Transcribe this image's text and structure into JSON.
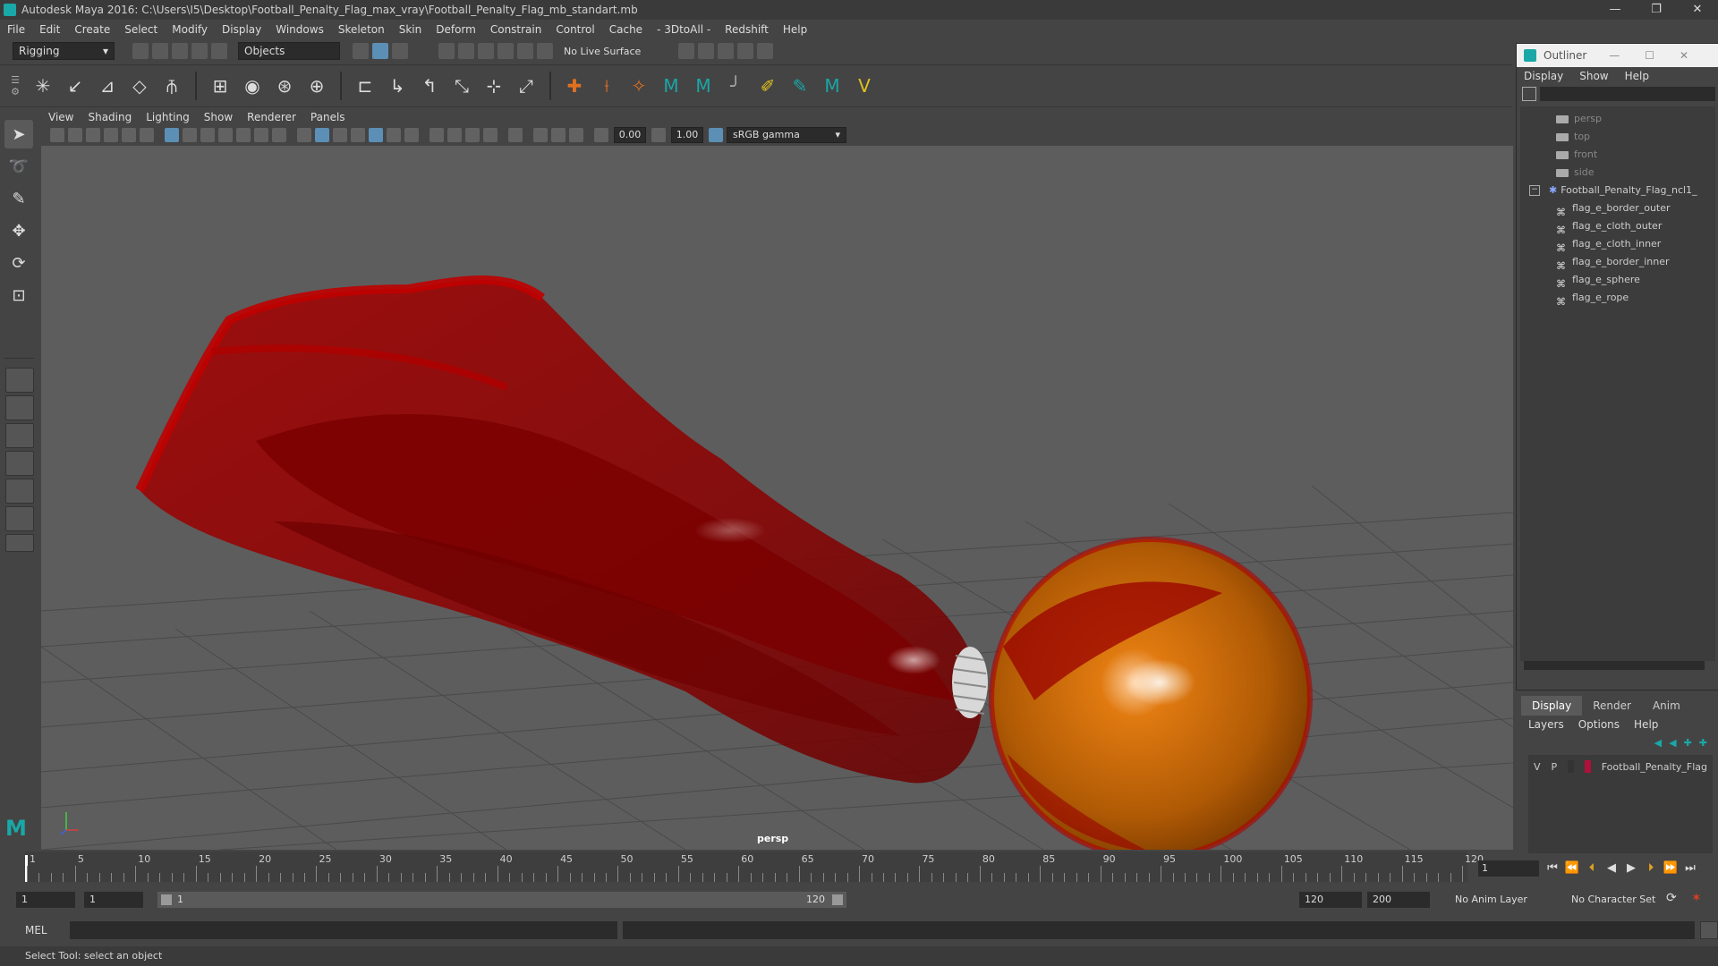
{
  "window": {
    "title": "Autodesk Maya 2016: C:\\Users\\I5\\Desktop\\Football_Penalty_Flag_max_vray\\Football_Penalty_Flag_mb_standart.mb",
    "minimize": "—",
    "restore": "❐",
    "close": "✕"
  },
  "menu": [
    "File",
    "Edit",
    "Create",
    "Select",
    "Modify",
    "Display",
    "Windows",
    "Skeleton",
    "Skin",
    "Deform",
    "Constrain",
    "Control",
    "Cache",
    "- 3DtoAll -",
    "Redshift",
    "Help"
  ],
  "status_line": {
    "mode": "Rigging",
    "selection_mode": "Objects",
    "live_surface": "No Live Surface"
  },
  "viewport": {
    "menu": [
      "View",
      "Shading",
      "Lighting",
      "Show",
      "Renderer",
      "Panels"
    ],
    "exposure": "0.00",
    "gamma": "1.00",
    "color_space": "sRGB gamma",
    "camera_label": "persp"
  },
  "outliner": {
    "title": "Outliner",
    "menu": [
      "Display",
      "Show",
      "Help"
    ],
    "cameras": [
      "persp",
      "top",
      "front",
      "side"
    ],
    "group": "Football_Penalty_Flag_ncl1_",
    "children": [
      "flag_e_border_outer",
      "flag_e_cloth_outer",
      "flag_e_cloth_inner",
      "flag_e_border_inner",
      "flag_e_sphere",
      "flag_e_rope"
    ]
  },
  "layer_editor": {
    "tabs": [
      "Display",
      "Render",
      "Anim"
    ],
    "menu": [
      "Layers",
      "Options",
      "Help"
    ],
    "layer": {
      "v": "V",
      "p": "P",
      "name": "Football_Penalty_Flag",
      "color": "#b0103a"
    }
  },
  "timeline": {
    "ticks": [
      "1",
      "5",
      "10",
      "15",
      "20",
      "25",
      "30",
      "35",
      "40",
      "45",
      "50",
      "55",
      "60",
      "65",
      "70",
      "75",
      "80",
      "85",
      "90",
      "95",
      "100",
      "105",
      "110",
      "115",
      "120"
    ],
    "current_frame": "1"
  },
  "range": {
    "start": "1",
    "playback_start": "1",
    "slider_start": "1",
    "slider_end": "120",
    "playback_end": "120",
    "end": "200",
    "anim_layer": "No Anim Layer",
    "char_set": "No Character Set"
  },
  "command_line": {
    "label": "MEL"
  },
  "help_line": {
    "text": "Select Tool: select an object"
  }
}
